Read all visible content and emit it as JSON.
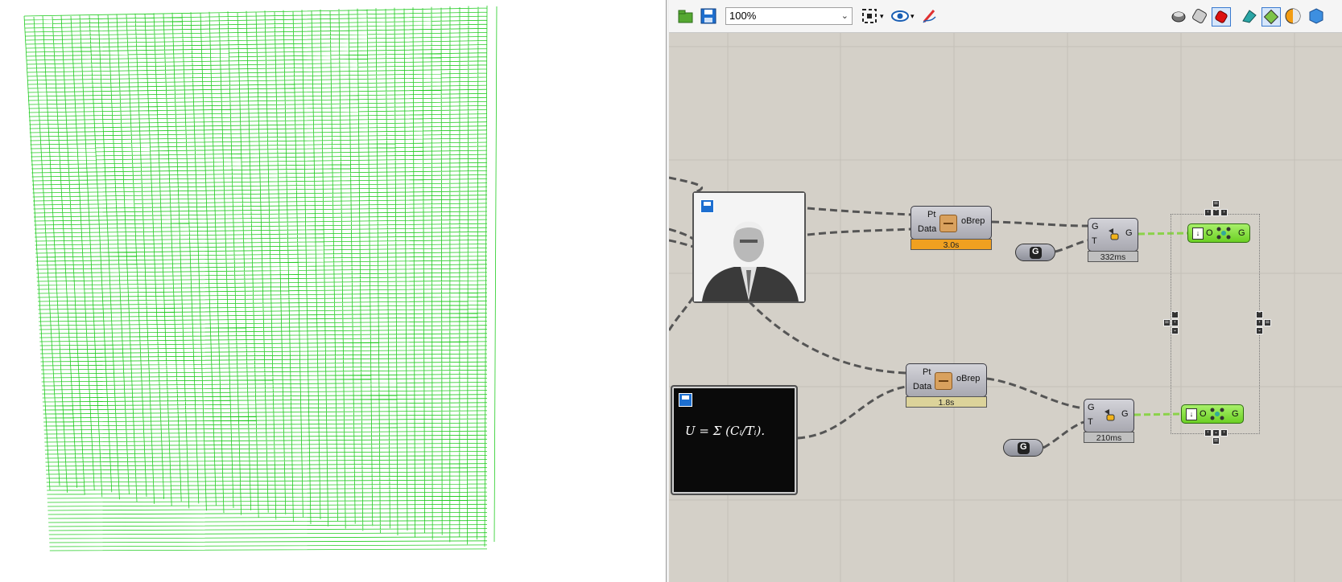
{
  "toolbar": {
    "zoom_value": "100%",
    "icons": [
      "open-file-icon",
      "save-file-icon",
      "zoom-extents-icon",
      "preview-eye-icon",
      "sketch-icon",
      "preview-off-icon",
      "preview-wire-icon",
      "preview-shaded-icon",
      "selected-only-icon",
      "mesh-preview-icon",
      "document-preview-icon",
      "sphere-icon"
    ]
  },
  "nodes": {
    "image_top": {
      "save_icon": "save-disk-icon"
    },
    "image_bottom": {
      "formula_text": "U = Σ (Cᵢ/Tᵢ).",
      "save_icon": "save-disk-icon"
    },
    "brep_top": {
      "input_pt": "Pt",
      "input_data": "Data",
      "output": "oBrep",
      "time": "3.0s"
    },
    "brep_bottom": {
      "input_pt": "Pt",
      "input_data": "Data",
      "output": "oBrep",
      "time": "1.8s"
    },
    "xform_top": {
      "input_g": "G",
      "input_t": "T",
      "output": "G",
      "time": "332ms"
    },
    "xform_bottom": {
      "input_g": "G",
      "input_t": "T",
      "output": "G",
      "time": "210ms"
    },
    "green_top": {
      "in": "O",
      "out": "G"
    },
    "green_bottom": {
      "in": "O",
      "out": "G"
    }
  },
  "colors": {
    "viewport_mesh": "#22cc22",
    "canvas_bg": "#d4d0c8",
    "orange_timer": "#f0a020",
    "tan_timer": "#dcd39a",
    "green_comp": "#7ed934"
  }
}
